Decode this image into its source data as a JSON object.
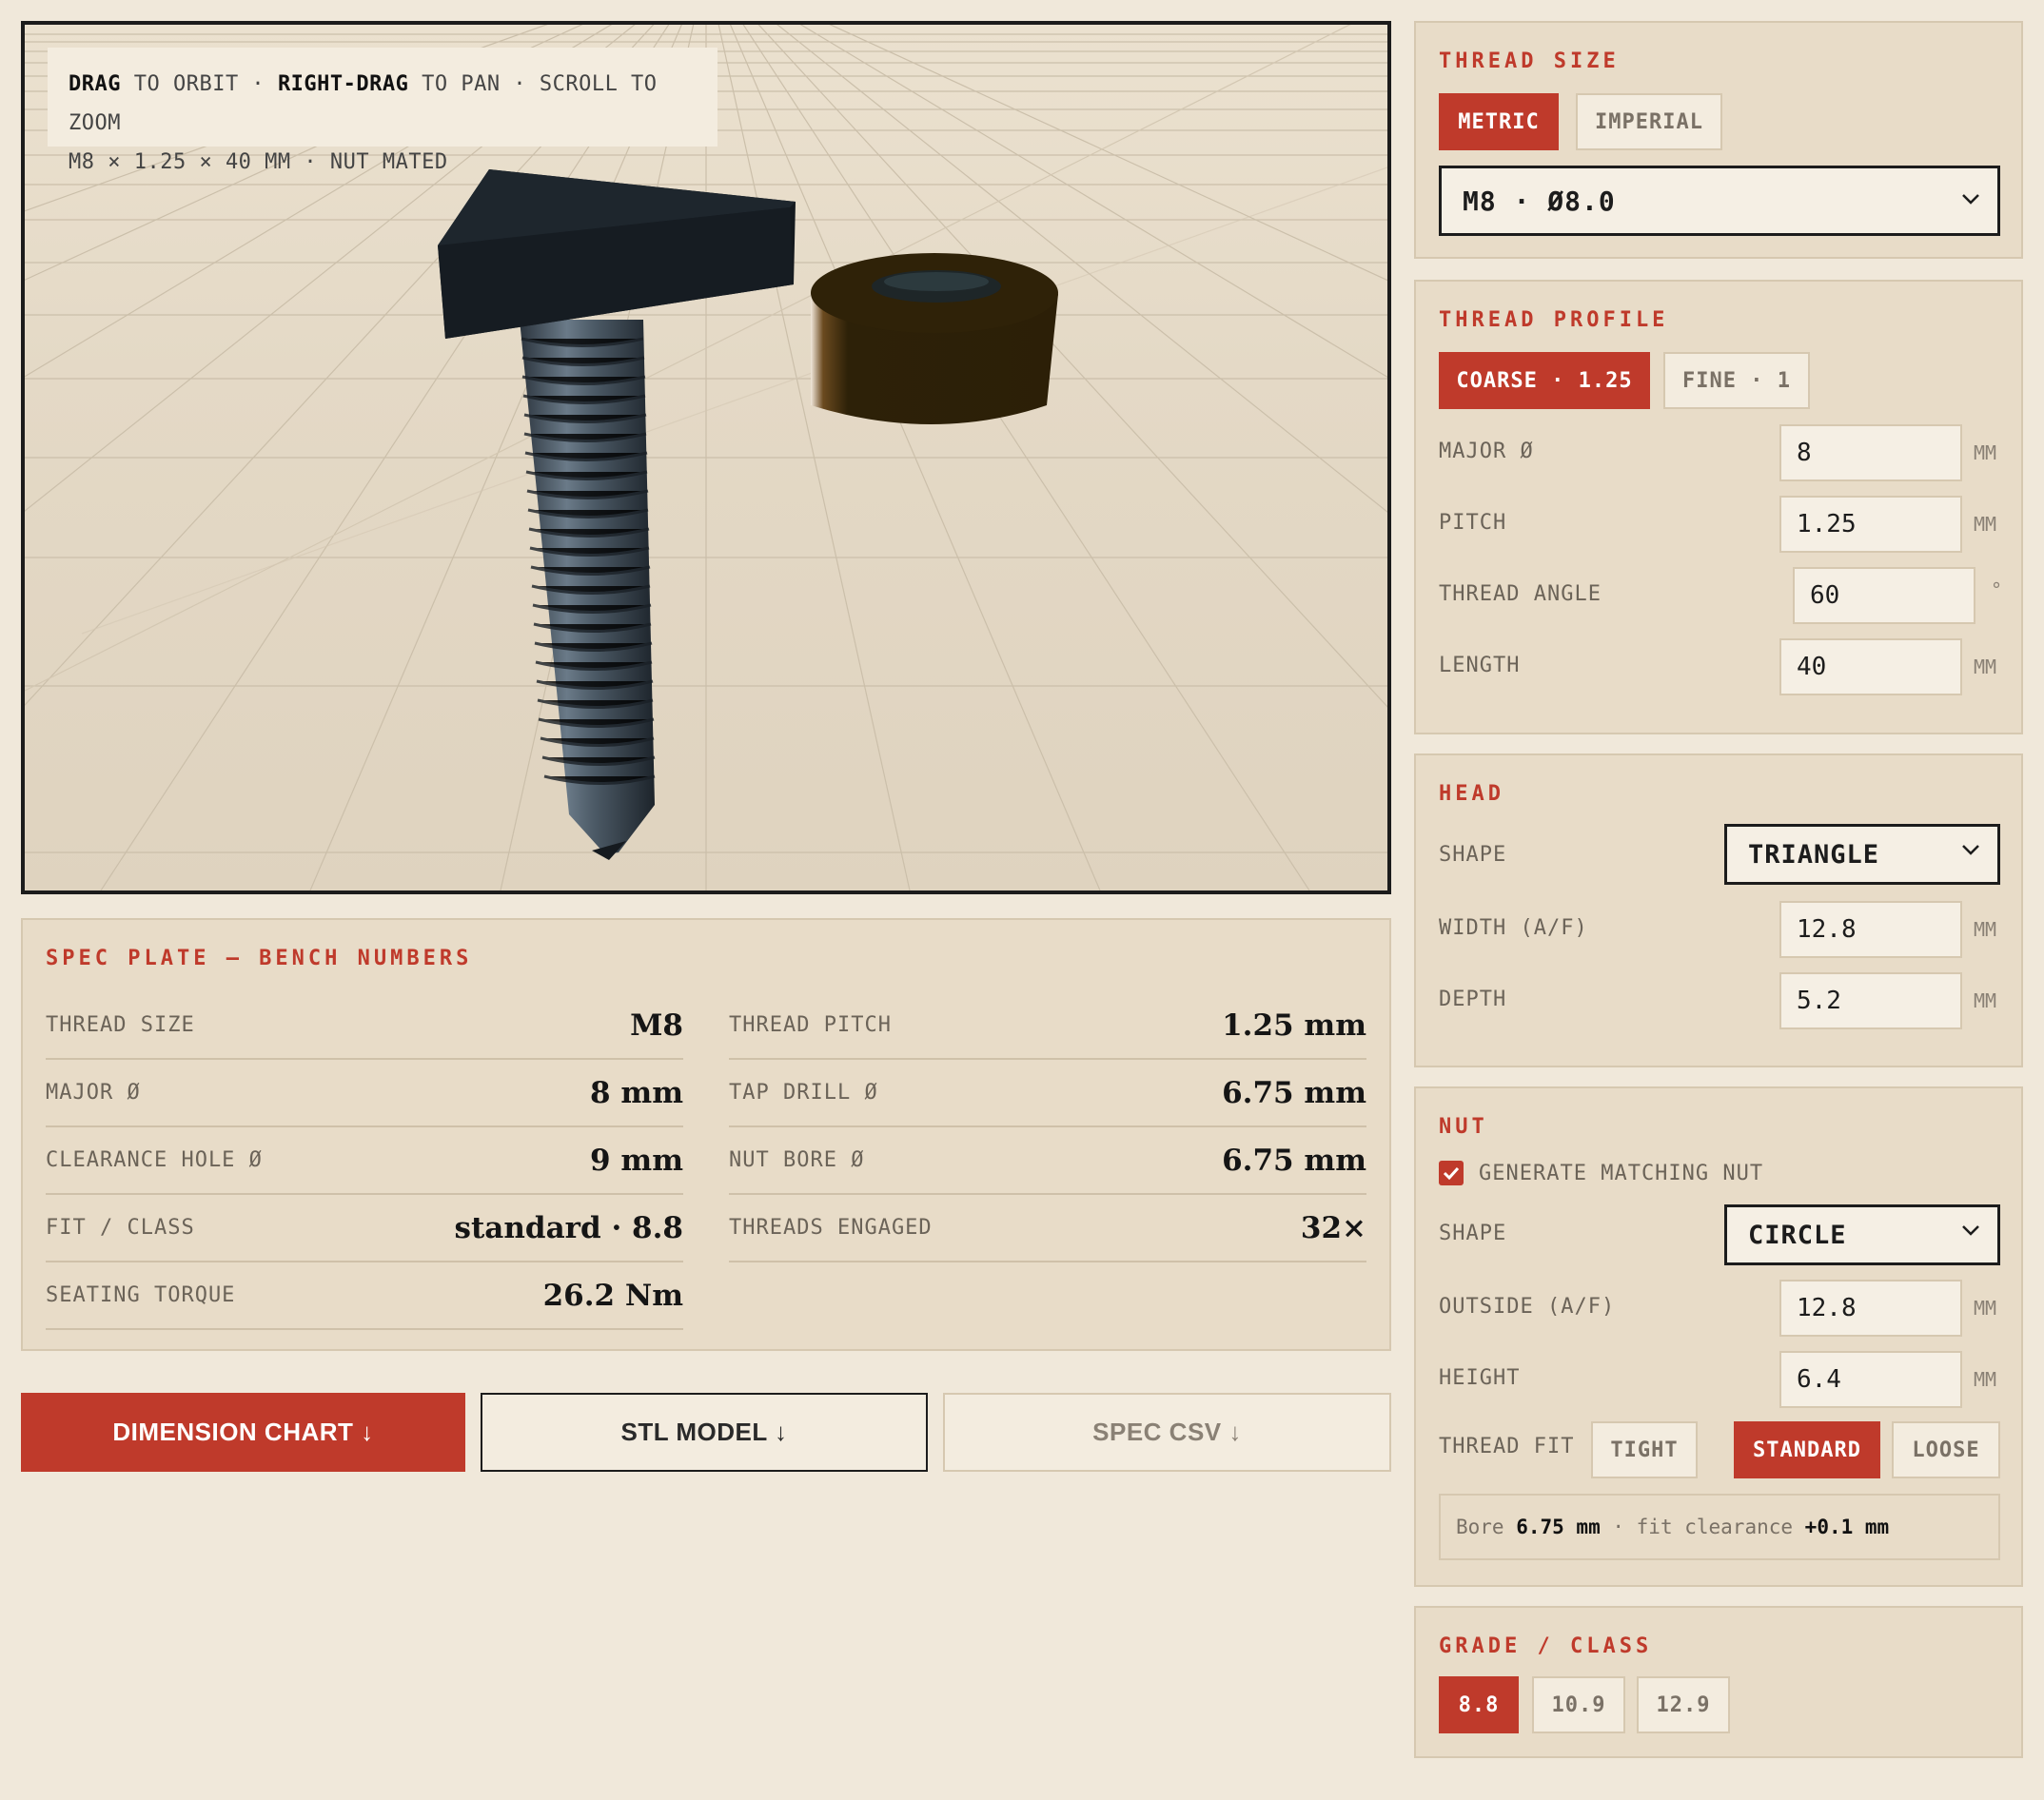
{
  "viewport": {
    "hint": {
      "drag": "DRAG",
      "to_orbit": " TO ORBIT · ",
      "right_drag": "RIGHT-DRAG",
      "to_pan": " TO PAN · SCROLL TO ZOOM"
    },
    "summary": "M8 × 1.25 × 40 MM · NUT MATED"
  },
  "spec_plate": {
    "title": "SPEC PLATE — BENCH NUMBERS",
    "left": [
      {
        "label": "THREAD SIZE",
        "value": "M8"
      },
      {
        "label": "MAJOR Ø",
        "value": "8 mm"
      },
      {
        "label": "CLEARANCE HOLE Ø",
        "value": "9 mm"
      },
      {
        "label": "FIT / CLASS",
        "value": "standard · 8.8"
      },
      {
        "label": "SEATING TORQUE",
        "value": "26.2 Nm"
      }
    ],
    "right": [
      {
        "label": "THREAD PITCH",
        "value": "1.25 mm"
      },
      {
        "label": "TAP DRILL Ø",
        "value": "6.75 mm"
      },
      {
        "label": "NUT BORE Ø",
        "value": "6.75 mm"
      },
      {
        "label": "THREADS ENGAGED",
        "value": "32×"
      }
    ]
  },
  "actions": {
    "dimension_chart": "DIMENSION CHART ↓",
    "stl_model": "STL MODEL ↓",
    "spec_csv": "SPEC CSV ↓"
  },
  "thread_size": {
    "title": "THREAD SIZE",
    "metric": "METRIC",
    "imperial": "IMPERIAL",
    "selected": "M8 · Ø8.0"
  },
  "thread_profile": {
    "title": "THREAD PROFILE",
    "coarse": "COARSE · 1.25",
    "fine": "FINE · 1",
    "major_label": "MAJOR Ø",
    "major_value": "8",
    "pitch_label": "PITCH",
    "pitch_value": "1.25",
    "angle_label": "THREAD ANGLE",
    "angle_value": "60",
    "angle_unit": "°",
    "length_label": "LENGTH",
    "length_value": "40",
    "unit": "MM"
  },
  "head": {
    "title": "HEAD",
    "shape_label": "SHAPE",
    "shape_value": "TRIANGLE",
    "width_label": "WIDTH (A/F)",
    "width_value": "12.8",
    "depth_label": "DEPTH",
    "depth_value": "5.2",
    "unit": "MM"
  },
  "nut": {
    "title": "NUT",
    "generate_label": "GENERATE MATCHING NUT",
    "generate_checked": true,
    "shape_label": "SHAPE",
    "shape_value": "CIRCLE",
    "outside_label": "OUTSIDE (A/F)",
    "outside_value": "12.8",
    "height_label": "HEIGHT",
    "height_value": "6.4",
    "unit": "MM",
    "fit_label": "THREAD FIT",
    "fit_tight": "TIGHT",
    "fit_standard": "STANDARD",
    "fit_loose": "LOOSE",
    "bore_text": "Bore ",
    "bore_value": "6.75 mm",
    "clearance_text": " · fit clearance ",
    "clearance_value": "+0.1 mm"
  },
  "grade": {
    "title": "GRADE / CLASS",
    "g1": "8.8",
    "g2": "10.9",
    "g3": "12.9"
  },
  "colors": {
    "accent": "#bf3a2b",
    "background": "#f0e8da",
    "panel": "#e8dcc8"
  }
}
